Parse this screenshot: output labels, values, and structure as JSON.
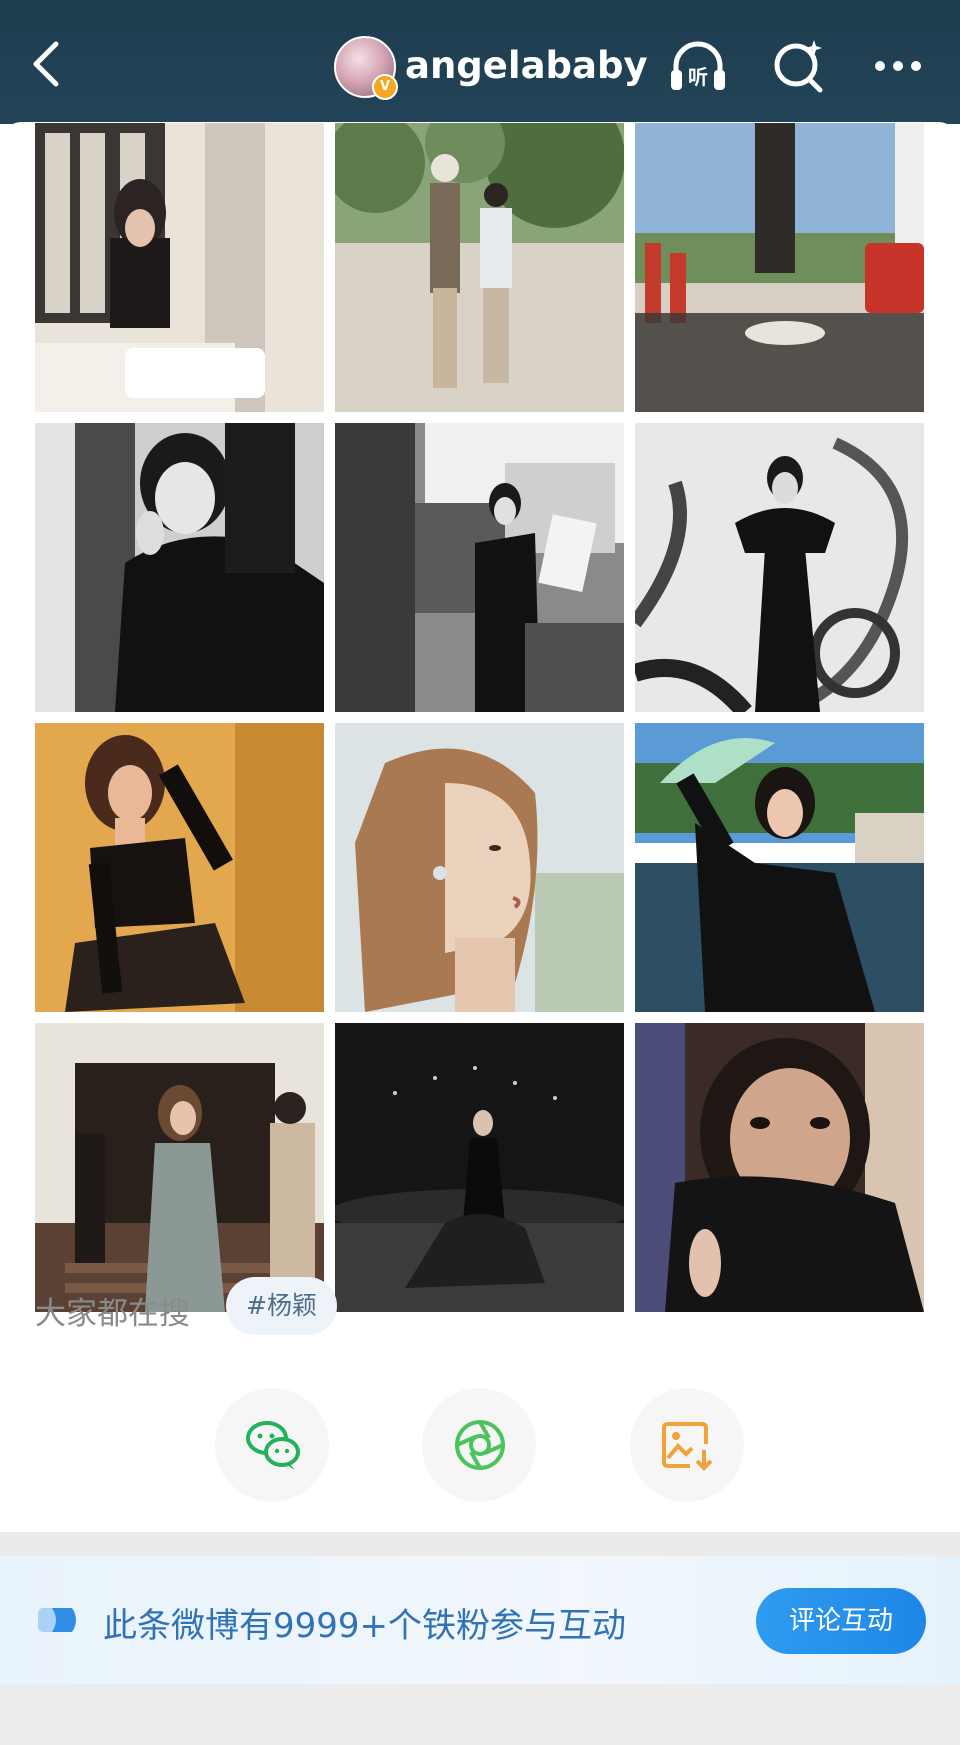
{
  "header": {
    "username": "angelababy",
    "verified_badge": "V",
    "icons": [
      "back-icon",
      "listen-icon",
      "search-icon",
      "more-icon"
    ],
    "listen_label": "听",
    "bg_color": "#1d3c4e"
  },
  "photos": [
    {
      "name": "photo-cafe-window",
      "colors": [
        "#cfc7bd",
        "#3a3633",
        "#efe9e2"
      ]
    },
    {
      "name": "photo-park-walk",
      "colors": [
        "#7f9b6b",
        "#d9d3c7",
        "#5d7a4a"
      ]
    },
    {
      "name": "photo-table-river-view",
      "colors": [
        "#7fa6c9",
        "#c9b9a6",
        "#3d3a36"
      ]
    },
    {
      "name": "photo-bw-portrait-chair",
      "colors": [
        "#d9d9d9",
        "#3a3a3a",
        "#111111"
      ]
    },
    {
      "name": "photo-bw-reading-window",
      "colors": [
        "#b5b5b5",
        "#444444",
        "#1a1a1a"
      ]
    },
    {
      "name": "photo-bw-graffiti-wall",
      "colors": [
        "#e6e6e6",
        "#777777",
        "#111111"
      ]
    },
    {
      "name": "photo-yellow-gown",
      "colors": [
        "#e6a94f",
        "#c98a34",
        "#1a1512"
      ]
    },
    {
      "name": "photo-profile-closeup",
      "colors": [
        "#dce3e4",
        "#c29a74",
        "#8a6244"
      ]
    },
    {
      "name": "photo-river-fan",
      "colors": [
        "#4b8ccc",
        "#2d4f63",
        "#111111"
      ]
    },
    {
      "name": "photo-staircase-event",
      "colors": [
        "#e8e4dc",
        "#3a2b22",
        "#8c8f8a"
      ]
    },
    {
      "name": "photo-stage-spotlight",
      "colors": [
        "#1b1b1b",
        "#3b3b3b",
        "#0b0b0b"
      ]
    },
    {
      "name": "photo-face-closeup",
      "colors": [
        "#3a2b26",
        "#cfa68c",
        "#141414"
      ]
    }
  ],
  "search": {
    "label": "大家都在搜",
    "tag": "#杨颖"
  },
  "share": {
    "icons": [
      "wechat-icon",
      "moments-icon",
      "save-image-icon"
    ],
    "colors": [
      "#23b15d",
      "#4cc35c",
      "#f2a23a"
    ]
  },
  "fan_bar": {
    "text": "此条微博有9999+个铁粉参与互动",
    "button": "评论互动",
    "accent": "#2f73b6"
  }
}
